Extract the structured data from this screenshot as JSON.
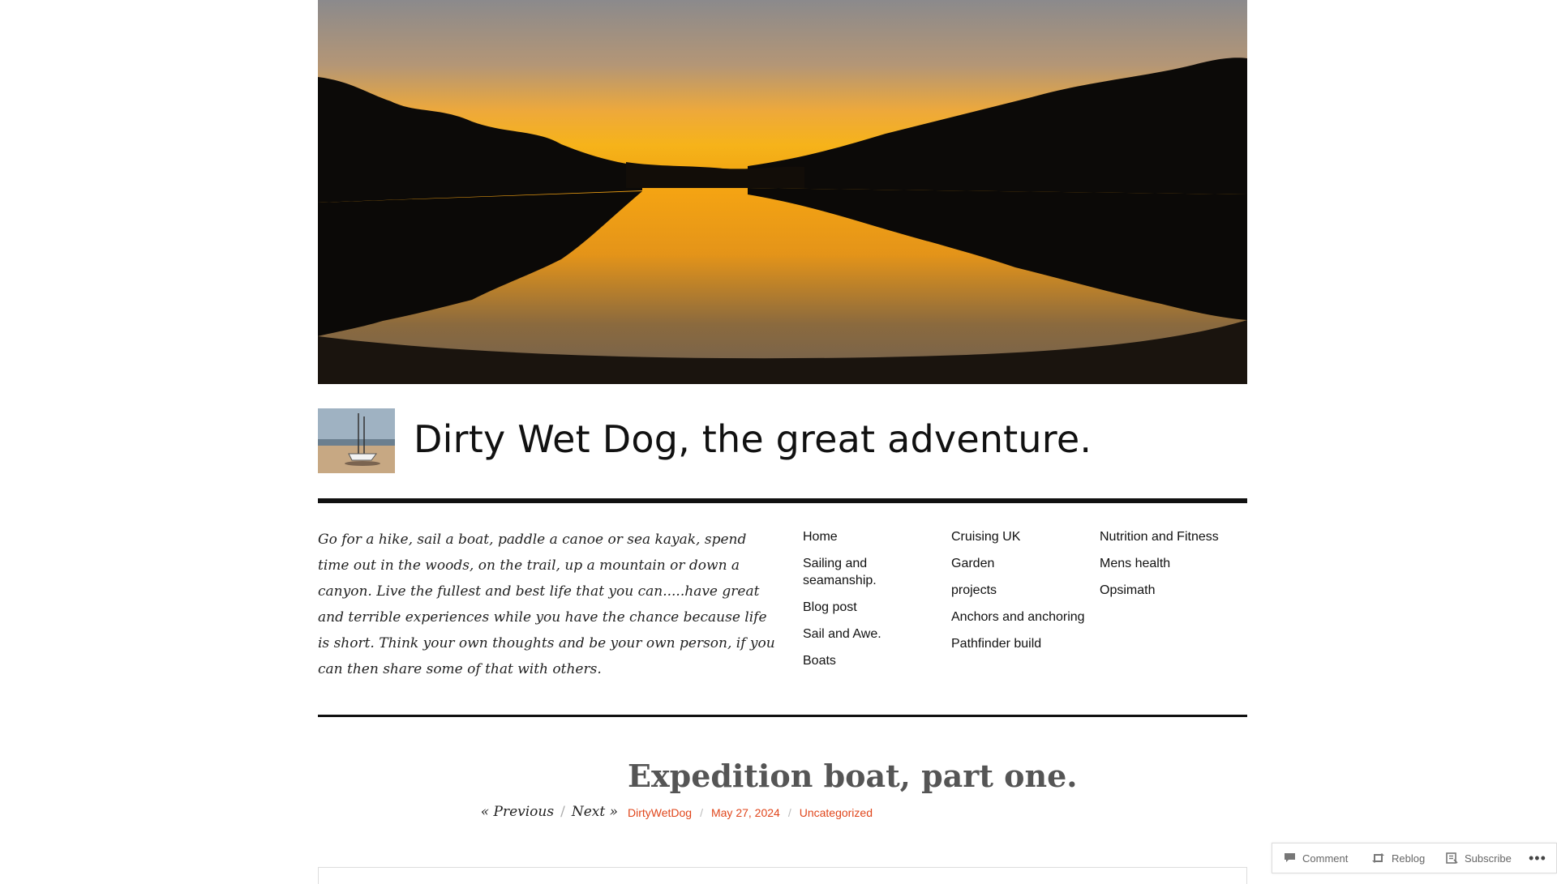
{
  "site": {
    "title": "Dirty Wet Dog, the great adventure.",
    "description": "Go for a hike, sail a boat, paddle a canoe or sea kayak, spend time out in the woods, on the trail, up a mountain or down a canyon. Live the fullest and best life that you can.....have great and terrible experiences while you have the chance because life is short. Think your own thoughts and be your own person, if you can then share some of that with others."
  },
  "nav": {
    "columns": [
      [
        "Home",
        "Sailing and seamanship.",
        "Blog post",
        "Sail and Awe.",
        "Boats"
      ],
      [
        "Cruising UK",
        "Garden",
        "projects",
        "Anchors and anchoring",
        "Pathfinder build"
      ],
      [
        "Nutrition and Fitness",
        "Mens health",
        "Opsimath"
      ]
    ]
  },
  "post": {
    "title": "Expedition boat, part one.",
    "previous_label": "« Previous",
    "next_label": "Next »",
    "nav_separator": "/",
    "author": "DirtyWetDog",
    "date": "May 27, 2024",
    "category": "Uncategorized",
    "meta_separator": "/"
  },
  "actionbar": {
    "comment_label": "Comment",
    "reblog_label": "Reblog",
    "subscribe_label": "Subscribe",
    "more_label": "•••"
  },
  "colors": {
    "accent": "#e0461b",
    "title_gray": "#555555",
    "text": "#111111"
  },
  "icons": [
    "comment-icon",
    "reblog-icon",
    "subscribe-icon",
    "more-icon"
  ]
}
